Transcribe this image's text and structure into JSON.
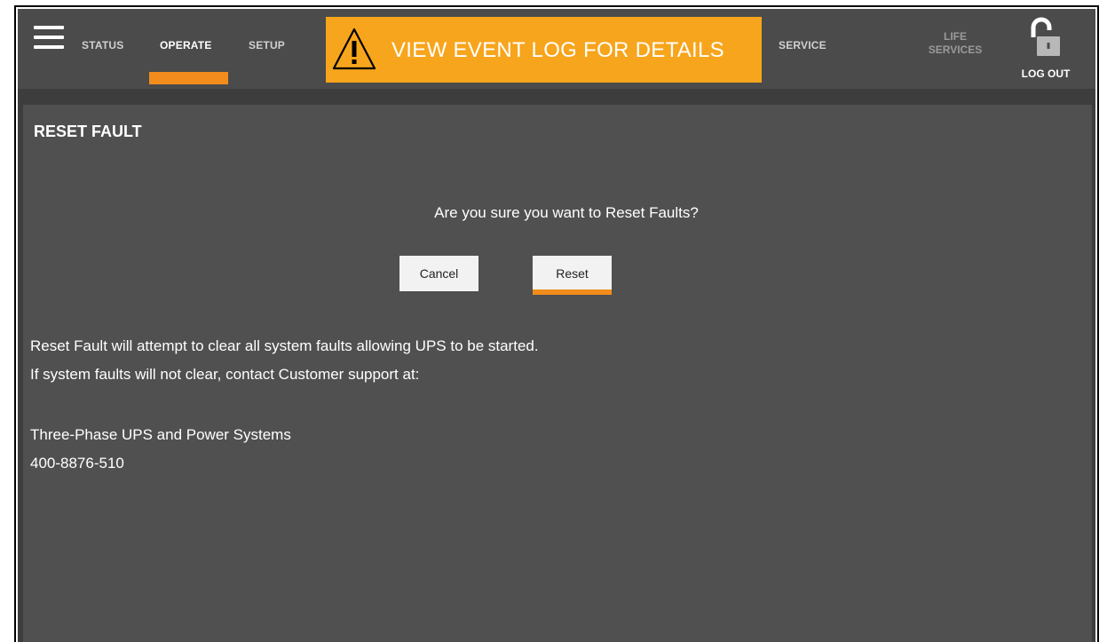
{
  "header": {
    "menu_icon": "hamburger-menu-icon",
    "tabs": [
      {
        "label": "STATUS",
        "active": false
      },
      {
        "label": "OPERATE",
        "active": true
      },
      {
        "label": "SETUP",
        "active": false
      }
    ],
    "alert": {
      "icon": "warning-triangle-icon",
      "text": "VIEW EVENT LOG FOR DETAILS",
      "color": "#f7a51c"
    },
    "service_label": "SERVICE",
    "life_services_label": [
      "LIFE",
      "SERVICES"
    ],
    "logout": {
      "icon": "unlocked-padlock-icon",
      "label": "LOG OUT"
    },
    "accent_color": "#f28c1c"
  },
  "dialog": {
    "title": "RESET FAULT",
    "question": "Are you sure you want to Reset Faults?",
    "cancel_label": "Cancel",
    "reset_label": "Reset",
    "info_lines": [
      "Reset Fault will attempt to clear all system faults allowing UPS to be started.",
      "If system faults will not clear, contact Customer support at:"
    ],
    "contact_name": "Three-Phase UPS and Power Systems",
    "contact_phone": "400-8876-510"
  }
}
